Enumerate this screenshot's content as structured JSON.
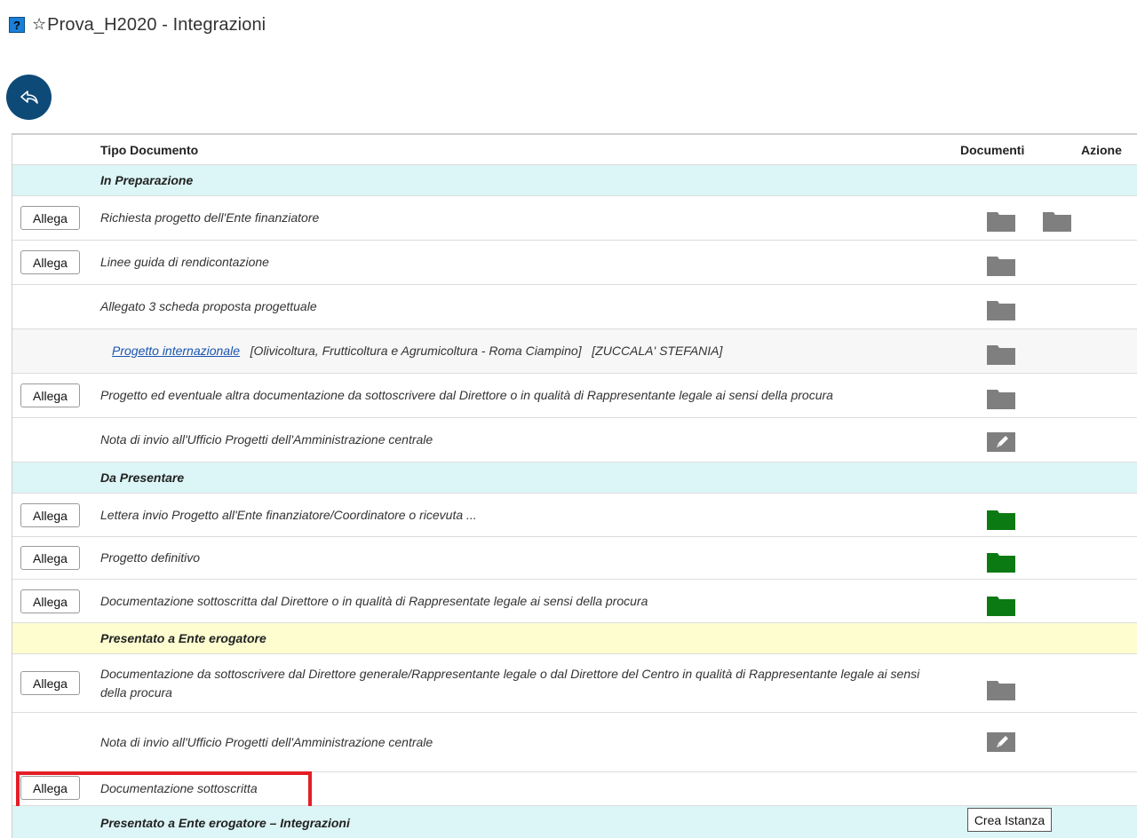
{
  "header": {
    "title": "Prova_H2020 - Integrazioni",
    "help_glyph": "?",
    "star_glyph": "☆"
  },
  "table": {
    "col_tipo": "Tipo Documento",
    "col_documenti": "Documenti",
    "col_azione": "Azione"
  },
  "sections": {
    "in_preparazione": "In Preparazione",
    "da_presentare": "Da Presentare",
    "presentato": "Presentato a Ente erogatore",
    "presentato_integrazioni": "Presentato a Ente erogatore – Integrazioni"
  },
  "rows": {
    "r1": "Richiesta progetto dell'Ente finanziatore",
    "r2": "Linee guida di rendicontazione",
    "r3": "Allegato 3 scheda proposta progettuale",
    "r4_link": "Progetto internazionale",
    "r4_tail": "[Olivicoltura, Frutticoltura e Agrumicoltura - Roma Ciampino]   [ZUCCALA' STEFANIA]",
    "r5": "Progetto ed eventuale altra documentazione da sottoscrivere dal Direttore o in qualità di Rappresentante legale ai sensi della procura",
    "r6": "Nota di invio all'Ufficio Progetti dell'Amministrazione centrale",
    "r7": "Lettera invio Progetto all'Ente finanziatore/Coordinatore o ricevuta ...",
    "r8": "Progetto definitivo",
    "r9": "Documentazione sottoscritta dal Direttore o in qualità di Rappresentate legale ai sensi della procura",
    "r10": "Documentazione da sottoscrivere dal Direttore generale/Rappresentante legale o dal Direttore del Centro in qualità di Rappresentante legale ai sensi della procura",
    "r11": "Nota di invio all'Ufficio Progetti dell'Amministrazione centrale",
    "r12": "Documentazione sottoscritta"
  },
  "buttons": {
    "allega": "Allega",
    "crea_istanza": "Crea Istanza"
  },
  "colors": {
    "folder_gray": "#7f7f7f",
    "folder_green": "#0b7a12",
    "back_button": "#0e4a78",
    "highlight": "#e41e26"
  }
}
